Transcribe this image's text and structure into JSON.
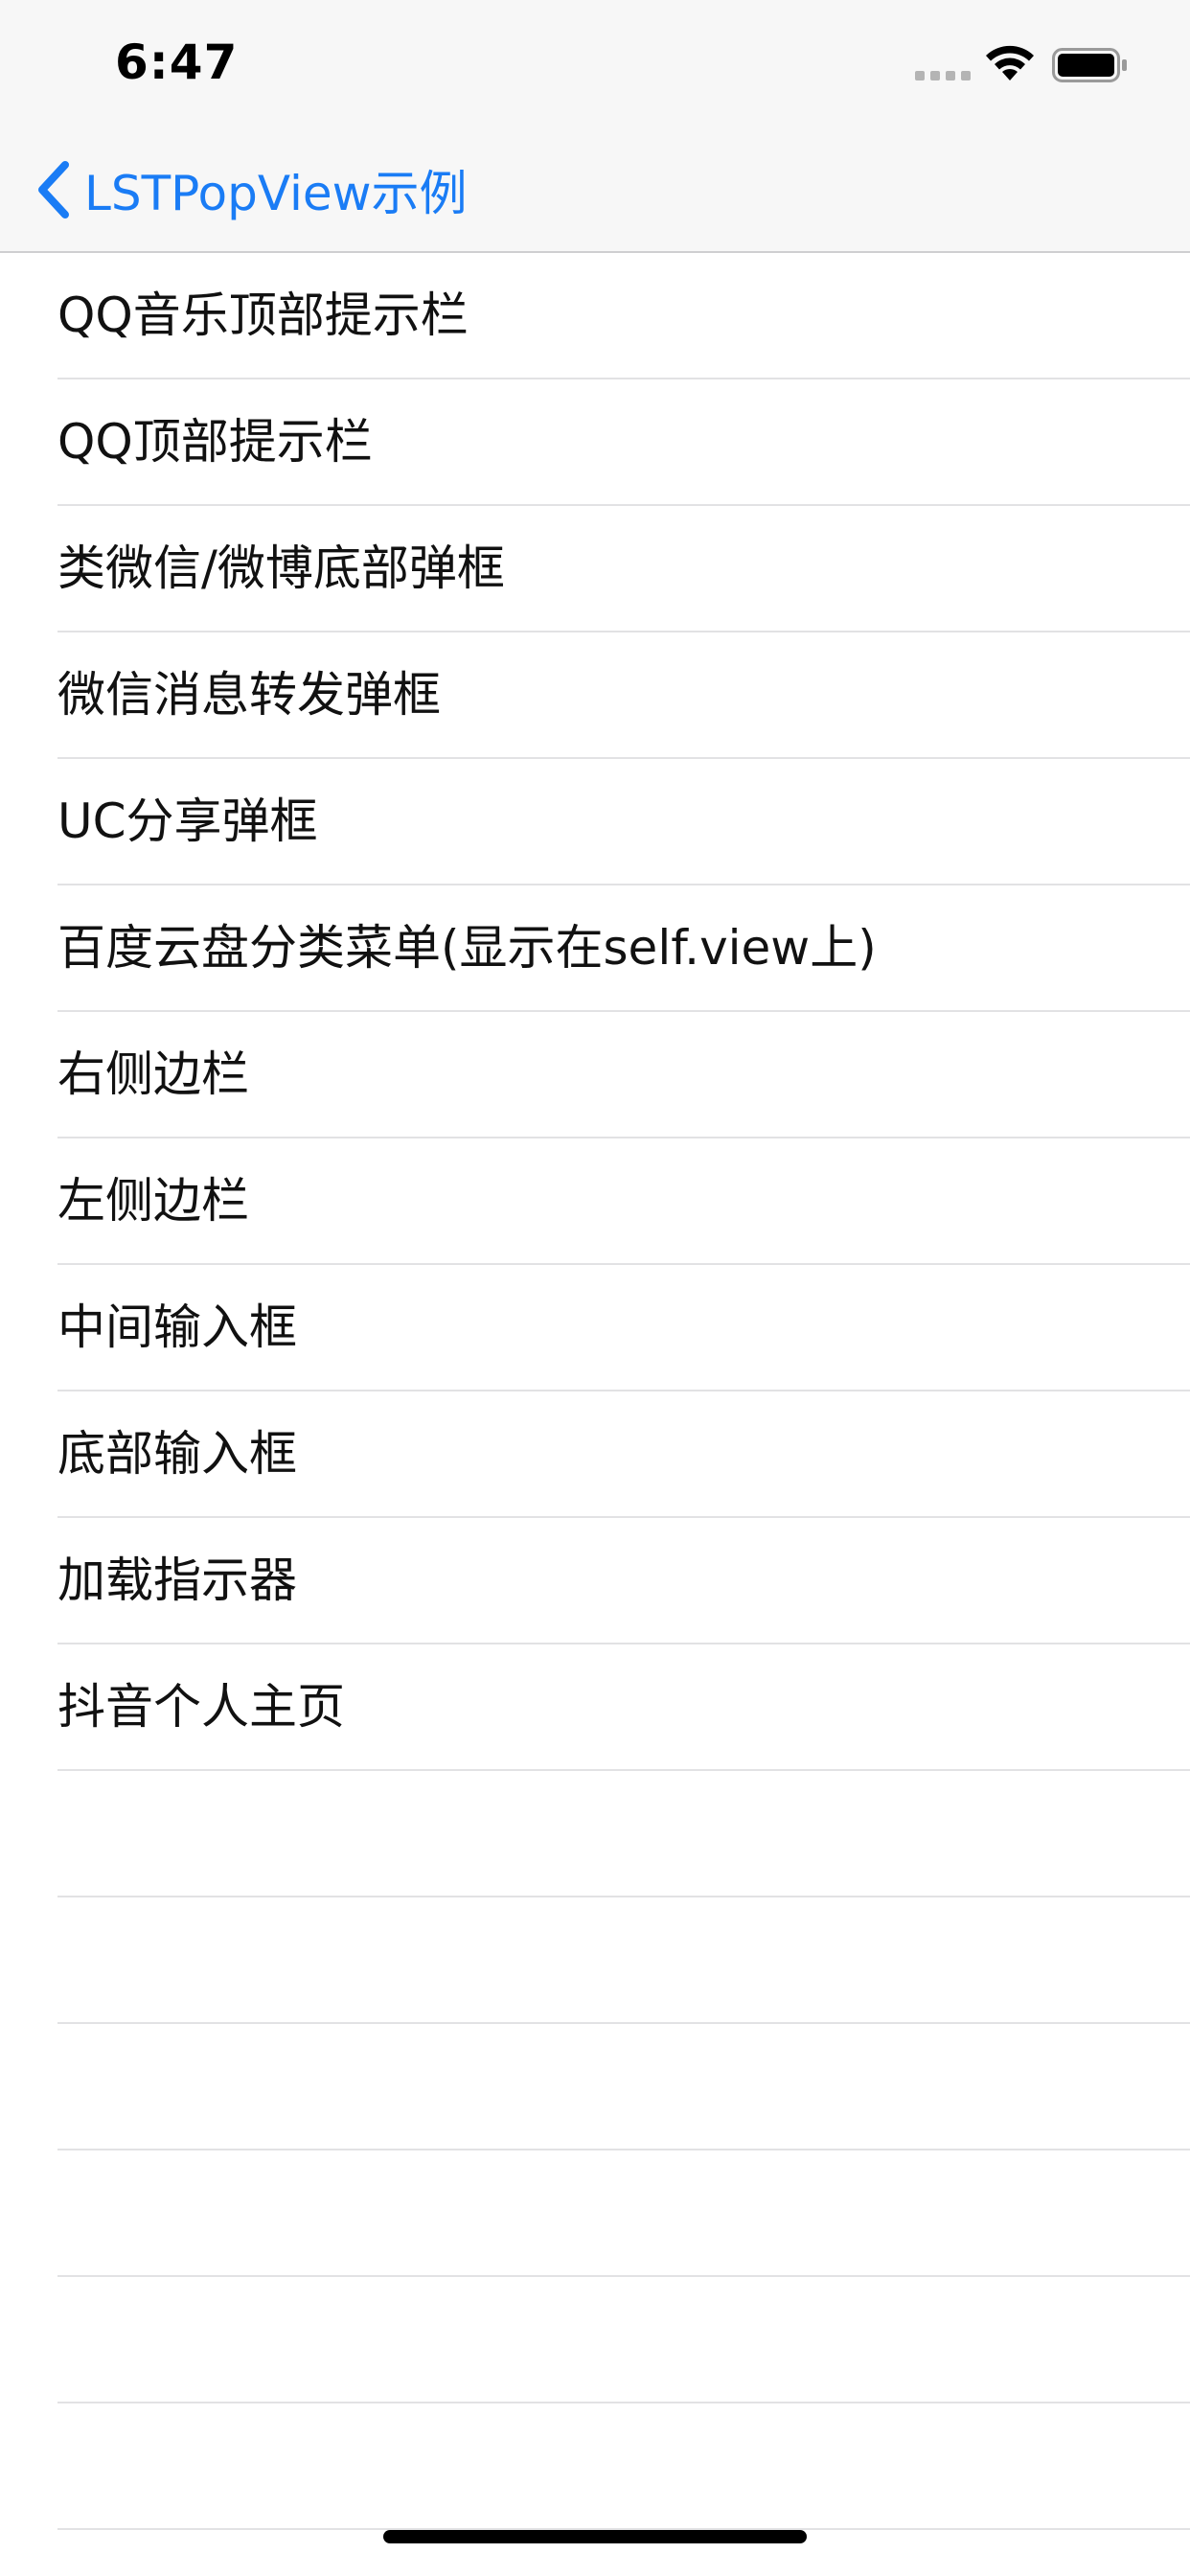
{
  "status_bar": {
    "time": "6:47"
  },
  "nav": {
    "back_label": "LSTPopView示例",
    "accent_color": "#1a7cf5"
  },
  "list": {
    "items": [
      "QQ音乐顶部提示栏",
      "QQ顶部提示栏",
      "类微信/微博底部弹框",
      "微信消息转发弹框",
      "UC分享弹框",
      "百度云盘分类菜单(显示在self.view上)",
      "右侧边栏",
      "左侧边栏",
      "中间输入框",
      "底部输入框",
      "加载指示器",
      "抖音个人主页"
    ]
  }
}
